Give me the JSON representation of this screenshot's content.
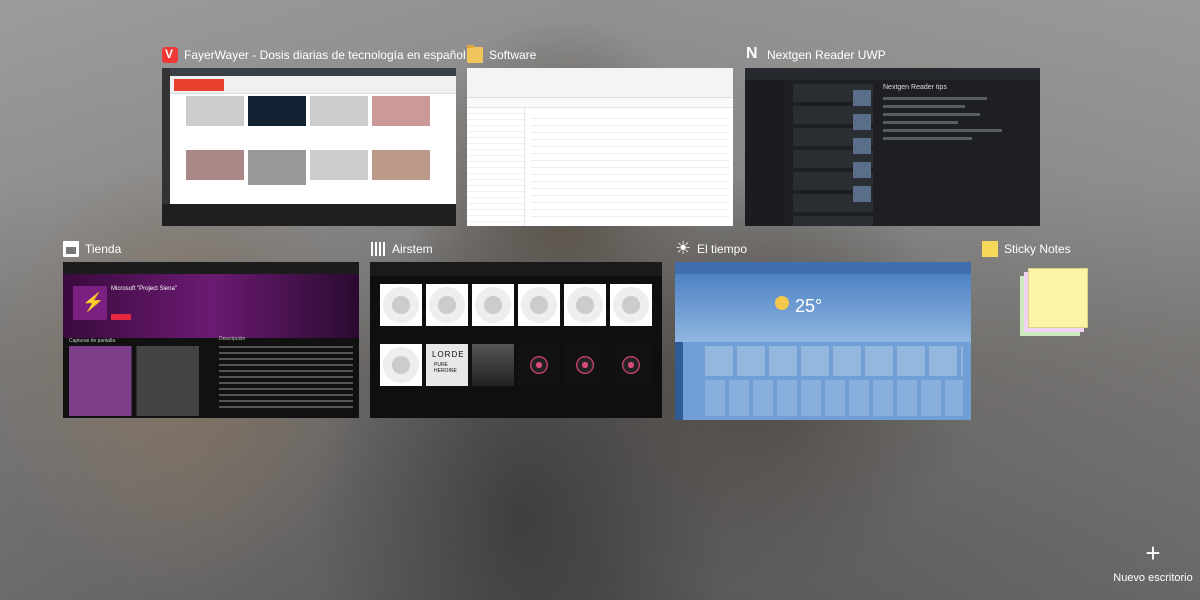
{
  "windows": {
    "fayerwayer": {
      "title": "FayerWayer - Dosis diarias de tecnología en español ™",
      "icon": "vivaldi-icon"
    },
    "explorer": {
      "title": "Software",
      "icon": "folder-icon"
    },
    "nextgen": {
      "title": "Nextgen Reader UWP",
      "icon": "nextgen-icon"
    },
    "tienda": {
      "title": "Tienda",
      "icon": "store-icon"
    },
    "airstem": {
      "title": "Airstem",
      "icon": "airstem-icon"
    },
    "tiempo": {
      "title": "El tiempo",
      "icon": "sun-icon"
    },
    "sticky": {
      "title": "Sticky Notes",
      "icon": "sticky-notes-icon"
    }
  },
  "thumbnails": {
    "nextgen_heading": "Nextgen Reader tips",
    "store_app_title": "Microsoft \"Project Siena\"",
    "store_section": "Capturas de pantalla",
    "store_description": "Descripción",
    "airstem_album": "LORDE",
    "airstem_album_sub": "PURE HEROINE",
    "weather_temp": "25°"
  },
  "new_desktop": {
    "label": "Nuevo escritorio",
    "icon": "plus-icon"
  }
}
